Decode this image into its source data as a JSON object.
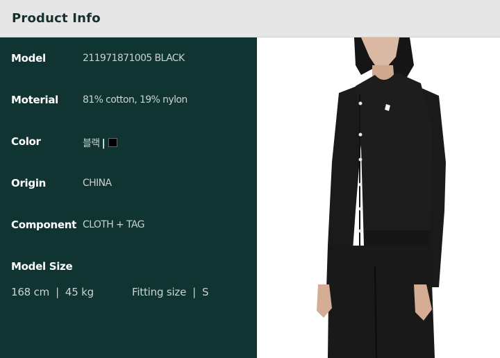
{
  "header": {
    "title": "Product Info"
  },
  "details": [
    {
      "label": "Model",
      "value": "211971871005 BLACK"
    },
    {
      "label": "Moterial",
      "value": "81% cotton, 19% nylon"
    },
    {
      "label": "Color",
      "value": "블랙"
    },
    {
      "label": "Origin",
      "value": "CHINA"
    },
    {
      "label": "Component",
      "value": "CLOTH + TAG"
    }
  ],
  "color_swatch": "#000000",
  "model_size": {
    "label": "Model Size",
    "height": "168 cm",
    "weight": "45 kg",
    "fitting_label": "Fitting size",
    "fitting_value": "S"
  }
}
